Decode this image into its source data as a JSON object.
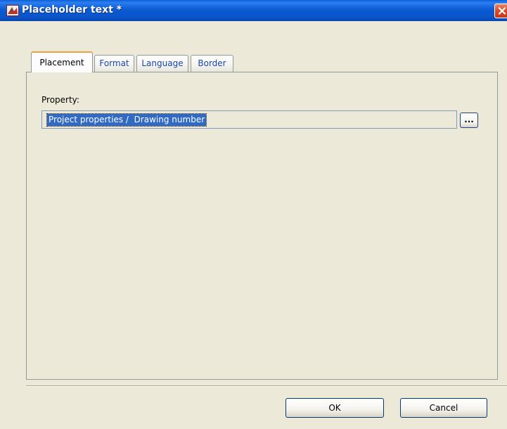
{
  "window": {
    "title": "Placeholder text *"
  },
  "tabs": [
    {
      "label": "Placement",
      "active": true
    },
    {
      "label": "Format",
      "active": false
    },
    {
      "label": "Language",
      "active": false
    },
    {
      "label": "Border",
      "active": false
    }
  ],
  "property": {
    "label": "Property:",
    "value": "Project properties /  Drawing number",
    "browse_label": "..."
  },
  "buttons": {
    "ok": "OK",
    "cancel": "Cancel"
  },
  "colors": {
    "titlebar": "#0a55cb",
    "dialog_bg": "#ece9d8",
    "selection": "#316ac5",
    "active_tab_accent": "#e8a33c",
    "close_button": "#d94a24"
  },
  "icons": {
    "app": "app-logo-icon",
    "close": "close-icon"
  }
}
